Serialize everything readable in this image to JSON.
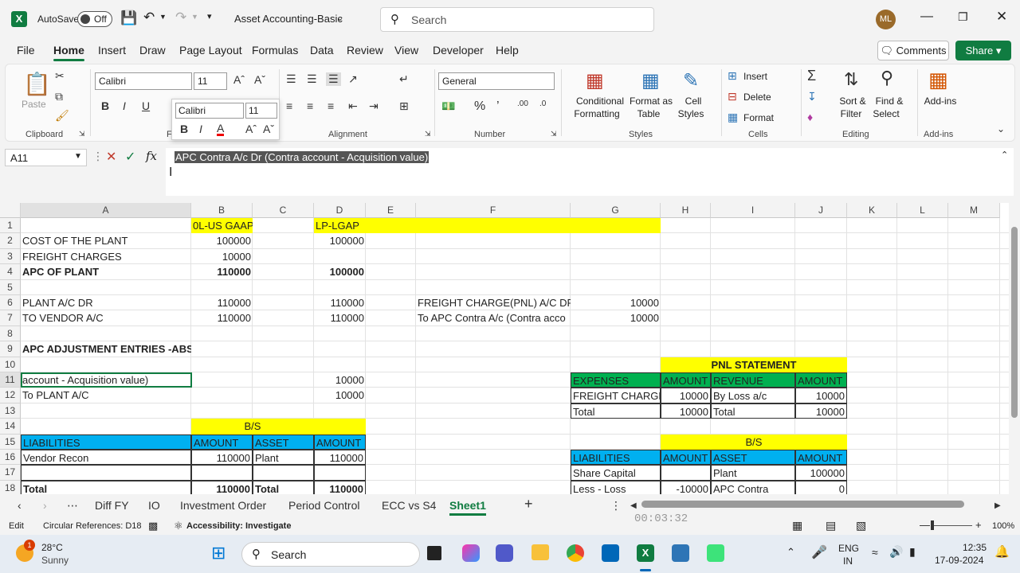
{
  "app": {
    "autosave_label": "AutoSave",
    "autosave_state": "Off",
    "doc_title": "Asset Accounting-Basic",
    "search_placeholder": "Search",
    "avatar_initials": "ML"
  },
  "menu": [
    "File",
    "Home",
    "Insert",
    "Draw",
    "Page Layout",
    "Formulas",
    "Data",
    "Review",
    "View",
    "Developer",
    "Help"
  ],
  "buttons": {
    "comments": "Comments",
    "share": "Share"
  },
  "ribbon": {
    "clipboard": {
      "paste": "Paste",
      "label": "Clipboard"
    },
    "font": {
      "name": "Calibri",
      "size": "11",
      "label": "F"
    },
    "mini": {
      "name": "Calibri",
      "size": "11"
    },
    "alignment_label": "Alignment",
    "number": {
      "format": "General",
      "label": "Number"
    },
    "styles": {
      "cond1": "Conditional",
      "cond2": "Formatting",
      "fmt1": "Format as",
      "fmt2": "Table",
      "cell1": "Cell",
      "cell2": "Styles",
      "label": "Styles"
    },
    "cells": {
      "insert": "Insert",
      "delete": "Delete",
      "format": "Format",
      "label": "Cells"
    },
    "editing": {
      "sort1": "Sort &",
      "sort2": "Filter",
      "find1": "Find &",
      "find2": "Select",
      "label": "Editing"
    },
    "addins": {
      "btn": "Add-ins",
      "label": "Add-ins"
    }
  },
  "formula": {
    "namebox": "A11",
    "content": "APC Contra A/c Dr (Contra account - Acquisition value)"
  },
  "columns": [
    "A",
    "B",
    "C",
    "D",
    "E",
    "F",
    "G",
    "H",
    "I",
    "J",
    "K",
    "L",
    "M"
  ],
  "rows": [
    "1",
    "2",
    "3",
    "4",
    "5",
    "6",
    "7",
    "8",
    "9",
    "10",
    "11",
    "12",
    "13",
    "14",
    "15",
    "16",
    "17",
    "18"
  ],
  "cells": {
    "B1": "0L-US GAAP",
    "D1": "LP-LGAP",
    "A2": "COST OF THE PLANT",
    "B2": "100000",
    "D2": "100000",
    "A3": "FREIGHT CHARGES",
    "B3": "10000",
    "A4": "APC OF PLANT",
    "B4": "110000",
    "D4": "100000",
    "A6": "PLANT A/C DR",
    "B6": "110000",
    "D6": "110000",
    "F6": "FREIGHT CHARGE(PNL) A/C DR",
    "G6": "10000",
    "A7": "TO VENDOR A/C",
    "B7": "110000",
    "D7": "110000",
    "F7": "To APC Contra A/c (Contra acco",
    "G7": "10000",
    "A9": "APC ADJUSTMENT ENTRIES -ABSO",
    "H10": "PNL STATEMENT",
    "A11": "account - Acquisition value)",
    "D11": "10000",
    "G11": "EXPENSES",
    "H11": "AMOUNT",
    "I11": "REVENUE",
    "J11": "AMOUNT",
    "A12": "To PLANT A/C",
    "D12": "10000",
    "G12": "FREIGHT CHARGE",
    "H12": "10000",
    "I12": "By Loss a/c",
    "J12": "10000",
    "G13": "Total",
    "H13": "10000",
    "I13": "Total",
    "J13": "10000",
    "B14": "B/S",
    "A15": "LIABILITIES",
    "B15": "AMOUNT",
    "C15": "ASSET",
    "D15": "AMOUNT",
    "H15": "B/S",
    "A16": "Vendor Recon",
    "B16": "110000",
    "C16": "Plant",
    "D16": "110000",
    "G16": "LIABILITIES",
    "H16": "AMOUNT",
    "I16": "ASSET",
    "J16": "AMOUNT",
    "G17": "Share Capital",
    "I17": "Plant",
    "J17": "100000",
    "A18": "Total",
    "B18": "110000",
    "C18": "Total",
    "D18": "110000",
    "G18": "Less - Loss",
    "H18": "-10000",
    "I18": "APC Contra",
    "J18": "0"
  },
  "sheets": [
    "Diff FY",
    "IO",
    "Investment Order",
    "Period Control",
    "ECC vs S4",
    "Sheet1"
  ],
  "status": {
    "mode": "Edit",
    "circ": "Circular References: D18",
    "access": "Accessibility: Investigate",
    "timer": "00:03:32",
    "zoom": "100%"
  },
  "taskbar": {
    "temp": "28°C",
    "weather": "Sunny",
    "search": "Search",
    "lang1": "ENG",
    "lang2": "IN",
    "time": "12:35",
    "date": "17-09-2024",
    "badge": "1"
  },
  "colors": {
    "excel_green": "#107c41",
    "yellow": "#ffff00",
    "blue": "#00b0f0",
    "green": "#00b050"
  }
}
